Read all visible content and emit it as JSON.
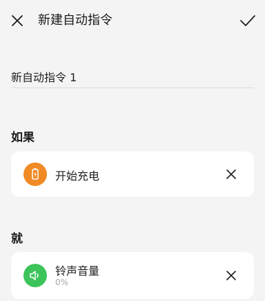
{
  "header": {
    "title": "新建自动指令"
  },
  "name_field": {
    "value": "新自动指令 1"
  },
  "if_section": {
    "label": "如果",
    "trigger": {
      "title": "开始充电",
      "icon": "battery-charging-icon",
      "icon_color": "#f08a24"
    }
  },
  "then_section": {
    "label": "就",
    "action": {
      "title": "铃声音量",
      "subtitle": "0%",
      "icon": "speaker-icon",
      "icon_color": "#3cc35a"
    }
  }
}
